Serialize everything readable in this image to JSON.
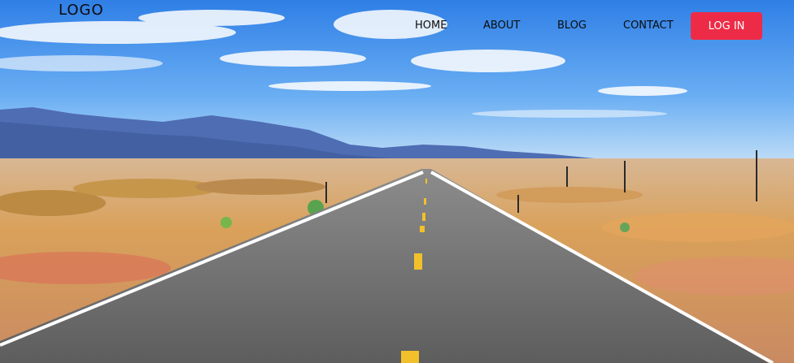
{
  "brand": {
    "logo_text": "LOGO"
  },
  "nav": {
    "items": [
      {
        "label": "HOME"
      },
      {
        "label": "ABOUT"
      },
      {
        "label": "BLOG"
      },
      {
        "label": "CONTACT"
      }
    ],
    "login_label": "LOG IN"
  },
  "colors": {
    "accent": "#ee2b47",
    "nav_text": "#0c0c0c",
    "sky_top": "#2f7fe6",
    "road": "#6f6f6f",
    "desert": "#d9a15a"
  },
  "hero": {
    "scene": "desert-highway"
  }
}
